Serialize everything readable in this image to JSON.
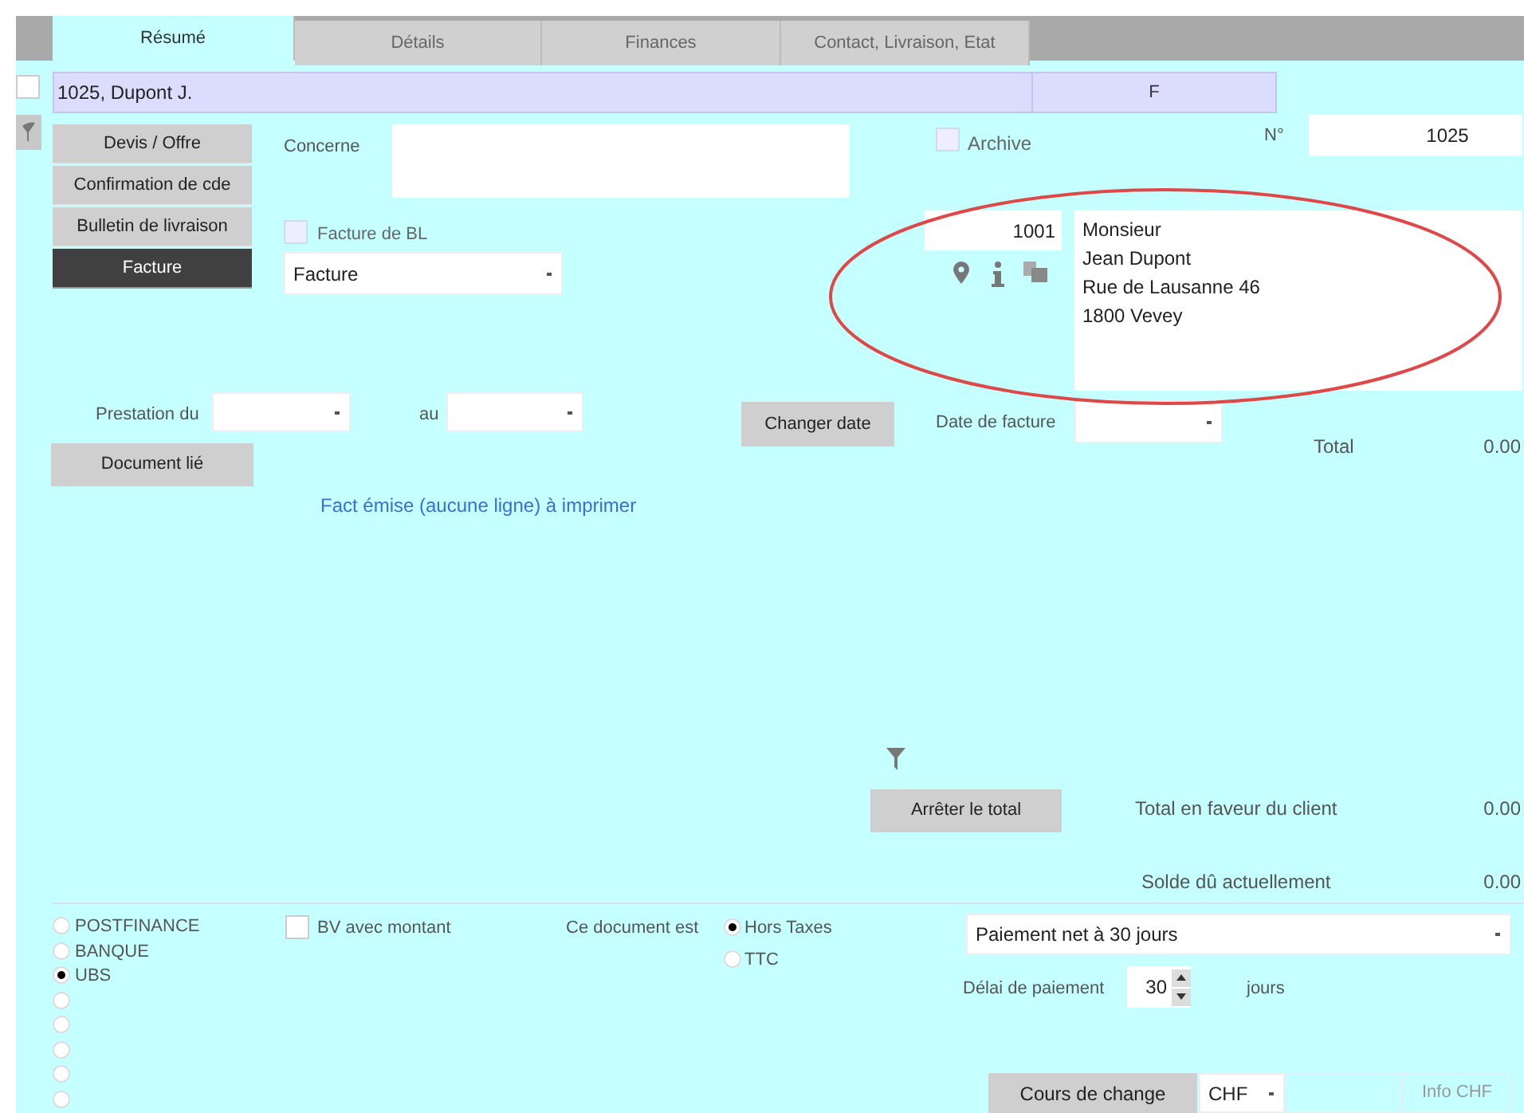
{
  "tabs": [
    {
      "label": "Résumé",
      "selected": true
    },
    {
      "label": "Détails",
      "selected": false
    },
    {
      "label": "Finances",
      "selected": false
    },
    {
      "label": "Contact, Livraison, Etat",
      "selected": false
    }
  ],
  "header": {
    "checked": false,
    "record": "1025, Dupont J.",
    "code": "F"
  },
  "document_types": [
    {
      "label": "Devis / Offre",
      "selected": false
    },
    {
      "label": "Confirmation de cde",
      "selected": false
    },
    {
      "label": "Bulletin de livraison",
      "selected": false
    },
    {
      "label": "Facture",
      "selected": true
    }
  ],
  "concerne": {
    "label": "Concerne"
  },
  "archive": {
    "label": "Archive",
    "checked": false
  },
  "number": {
    "label": "N°",
    "value": "1025"
  },
  "facture_de_bl": {
    "label": "Facture de BL",
    "checked": false
  },
  "document_select": {
    "value": "Facture"
  },
  "client": {
    "number": "1001",
    "address": [
      "Monsieur",
      "Jean Dupont",
      "Rue de Lausanne 46",
      "1800 Vevey"
    ]
  },
  "prestation": {
    "from_label": "Prestation du",
    "to_label": "au"
  },
  "changer_date": "Changer date",
  "date_facture": {
    "label": "Date de facture"
  },
  "total": {
    "label": "Total",
    "value": "0.00"
  },
  "document_lie": "Document lié",
  "status_message": "Fact émise (aucune ligne) à imprimer",
  "arreter_total": "Arrêter le total",
  "total_client": {
    "label": "Total en faveur du client",
    "value": "0.00"
  },
  "solde": {
    "label": "Solde dû actuellement",
    "value": "0.00"
  },
  "banks": [
    {
      "label": "POSTFINANCE",
      "selected": false
    },
    {
      "label": "BANQUE",
      "selected": false
    },
    {
      "label": "UBS",
      "selected": true
    },
    {
      "selected": false
    },
    {
      "selected": false
    },
    {
      "selected": false
    },
    {
      "selected": false
    },
    {
      "selected": false
    }
  ],
  "bv_montant": {
    "label": "BV avec montant",
    "checked": false
  },
  "tax_mode": {
    "label": "Ce document est",
    "options": [
      {
        "label": "Hors Taxes",
        "selected": true
      },
      {
        "label": "TTC",
        "selected": false
      }
    ]
  },
  "payment_terms": {
    "value": "Paiement net à 30 jours"
  },
  "delai": {
    "label": "Délai de paiement",
    "value": "30",
    "unit": "jours"
  },
  "cours_de_change": "Cours de change",
  "currency": {
    "value": "CHF"
  },
  "info_currency": {
    "label": "Info CHF",
    "disabled": true
  }
}
